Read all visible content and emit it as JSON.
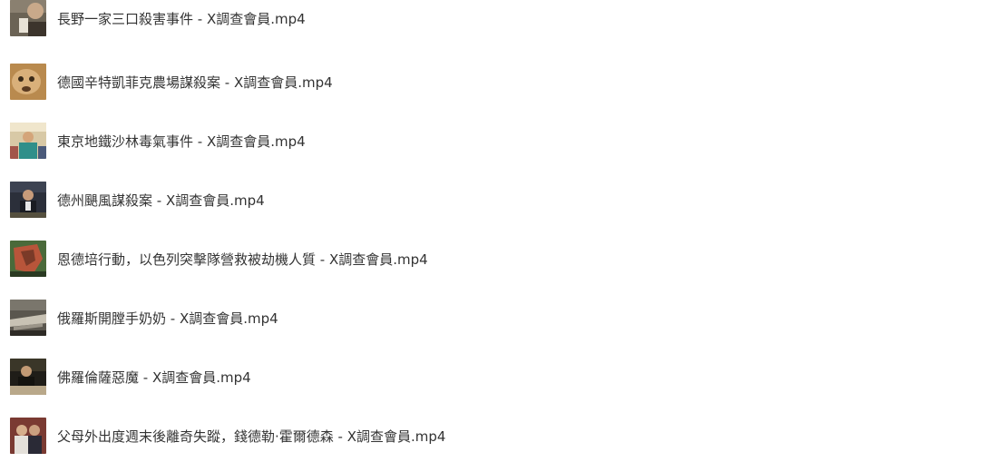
{
  "file_list": {
    "items": [
      {
        "name": "長野一家三口殺害事件 - X調查會員.mp4",
        "thumbnail_icon": "video-thumbnail-icon"
      },
      {
        "name": "德國辛特凱菲克農場謀殺案 - X調查會員.mp4",
        "thumbnail_icon": "video-thumbnail-icon"
      },
      {
        "name": "東京地鐵沙林毒氣事件 - X調查會員.mp4",
        "thumbnail_icon": "video-thumbnail-icon"
      },
      {
        "name": "德州颶風謀殺案 - X調查會員.mp4",
        "thumbnail_icon": "video-thumbnail-icon"
      },
      {
        "name": "恩德培行動，以色列突擊隊營救被劫機人質 - X調查會員.mp4",
        "thumbnail_icon": "video-thumbnail-icon"
      },
      {
        "name": "俄羅斯開膛手奶奶 - X調查會員.mp4",
        "thumbnail_icon": "video-thumbnail-icon"
      },
      {
        "name": "佛羅倫薩惡魔 - X調查會員.mp4",
        "thumbnail_icon": "video-thumbnail-icon"
      },
      {
        "name": "父母外出度週末後離奇失蹤，錢德勒·霍爾德森 - X調查會員.mp4",
        "thumbnail_icon": "video-thumbnail-icon"
      }
    ]
  },
  "colors": {
    "background": "#ffffff",
    "text": "#333333"
  }
}
